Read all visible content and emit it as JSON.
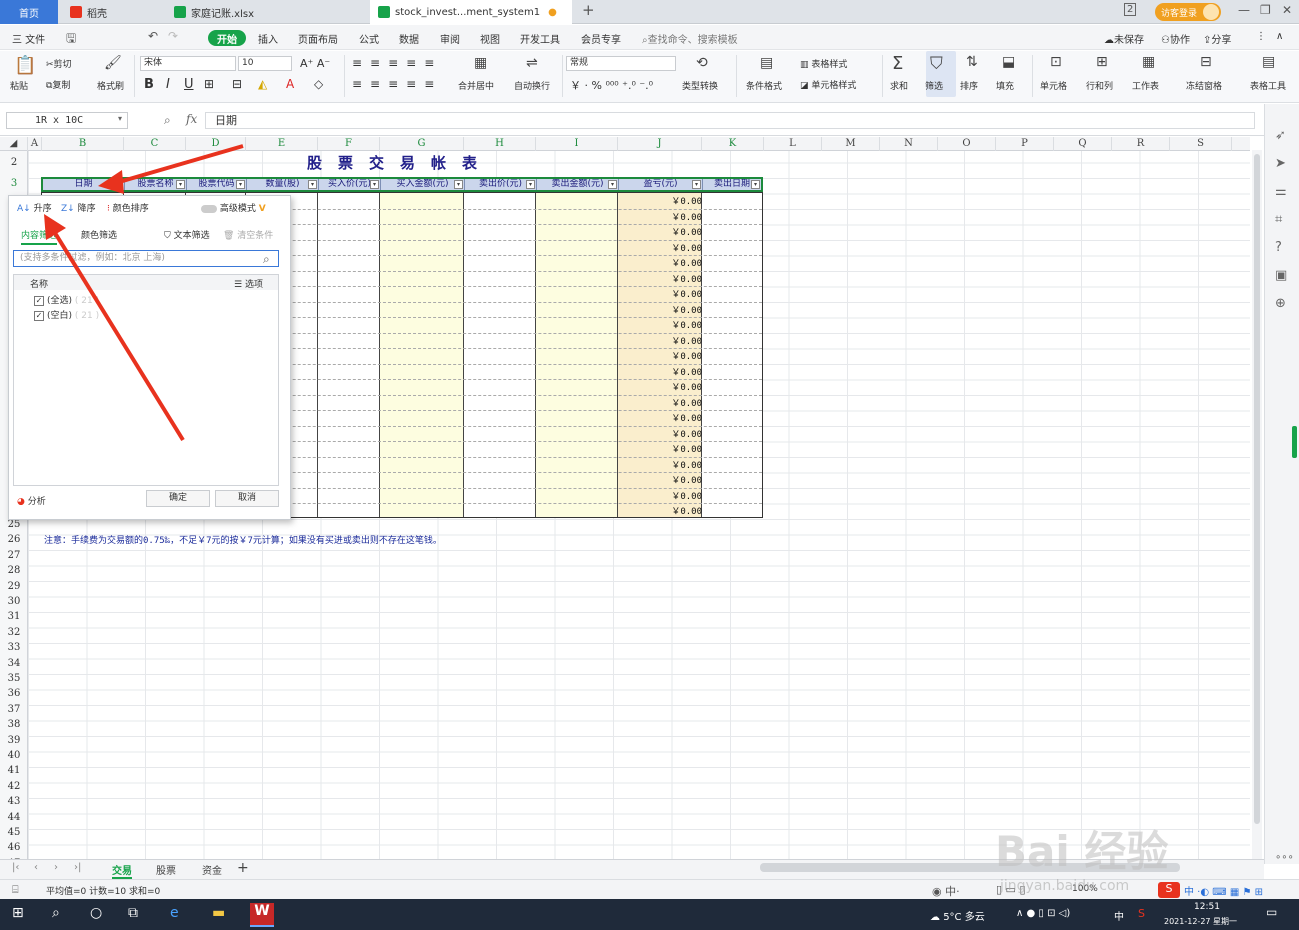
{
  "tabs": [
    {
      "label": "首页"
    },
    {
      "label": "稻壳"
    },
    {
      "label": "家庭记账.xlsx"
    },
    {
      "label": "stock_invest...ment_system1"
    }
  ],
  "window": {
    "page_num": "2",
    "login_label": "访客登录"
  },
  "menu": {
    "file": "三 文件",
    "start": "开始",
    "items": [
      "插入",
      "页面布局",
      "公式",
      "数据",
      "审阅",
      "视图",
      "开发工具",
      "会员专享"
    ],
    "search": "查找命令、搜索模板",
    "unsaved": "未保存",
    "collab": "协作",
    "share": "分享"
  },
  "ribbon": {
    "paste": "粘贴",
    "cut": "剪切",
    "copy": "复制",
    "format_painter": "格式刷",
    "font_name": "宋体",
    "font_size": "10",
    "number_format": "常规",
    "merge": "合并居中",
    "wrap": "自动换行",
    "type_convert": "类型转换",
    "cond_format": "条件格式",
    "table_style": "表格样式",
    "cell_style": "单元格样式",
    "sum": "求和",
    "filter": "筛选",
    "sort": "排序",
    "fill": "填充",
    "cell": "单元格",
    "rowcol": "行和列",
    "worksheet": "工作表",
    "freeze": "冻结窗格",
    "table_tools": "表格工具"
  },
  "formula": {
    "name_box": "1R x 10C",
    "fx": "fx",
    "value": "日期"
  },
  "columns": [
    "A",
    "B",
    "C",
    "D",
    "E",
    "F",
    "G",
    "H",
    "I",
    "J",
    "K",
    "L",
    "M",
    "N",
    "O",
    "P",
    "Q",
    "R",
    "S"
  ],
  "rows_top": [
    "2",
    "3"
  ],
  "rows_bottom": [
    "25",
    "26",
    "27",
    "28",
    "29",
    "30",
    "31",
    "32",
    "33",
    "34",
    "35",
    "36",
    "37",
    "38",
    "39",
    "40",
    "41",
    "42",
    "43",
    "44",
    "45",
    "46",
    "47"
  ],
  "sheet": {
    "title": "股票交易帐表",
    "headers": [
      "日期",
      "股票名称",
      "股票代码",
      "数量(股)",
      "买入价(元)",
      "买入金额(元)",
      "卖出价(元)",
      "卖出金额(元)",
      "盈亏(元)",
      "卖出日期"
    ],
    "profit_values": [
      "￥0.00",
      "￥0.00",
      "￥0.00",
      "￥0.00",
      "￥0.00",
      "￥0.00",
      "￥0.00",
      "￥0.00",
      "￥0.00",
      "￥0.00",
      "￥0.00",
      "￥0.00",
      "￥0.00",
      "￥0.00",
      "￥0.00",
      "￥0.00",
      "￥0.00",
      "￥0.00",
      "￥0.00",
      "￥0.00",
      "￥0.00"
    ],
    "note": "注意：手续费为交易额的0.75‰，不足￥7元的按￥7元计算；如果没有买进或卖出则不存在这笔钱。"
  },
  "filter_popup": {
    "asc": "升序",
    "desc": "降序",
    "color_sort": "颜色排序",
    "advanced": "高级模式",
    "tab_content": "内容筛选",
    "tab_color": "颜色筛选",
    "text_filter": "文本筛选",
    "clear": "清空条件",
    "search_placeholder": "(支持多条件过滤，例如：北京 上海)",
    "list_header": "名称",
    "options": "选项",
    "items": [
      {
        "label": "(全选)",
        "count": "( 21 )"
      },
      {
        "label": "(空白)",
        "count": "( 21 )"
      }
    ],
    "analysis": "分析",
    "ok": "确定",
    "cancel": "取消"
  },
  "sheet_tabs": [
    "交易",
    "股票",
    "资金"
  ],
  "status": {
    "summary": "平均值=0  计数=10  求和=0",
    "zoom": "100%"
  },
  "taskbar": {
    "weather": "5°C 多云",
    "ime": "中",
    "time": "12:51",
    "date": "2021-12-27 星期一"
  },
  "watermark": {
    "text": "Bai 经验",
    "url": "jingyan.baidu.com"
  },
  "colors": {
    "accent_green": "#17a34a",
    "home_tab": "#3a78d8",
    "header_fill": "#cbd6ec",
    "arrow": "#e8321e"
  }
}
